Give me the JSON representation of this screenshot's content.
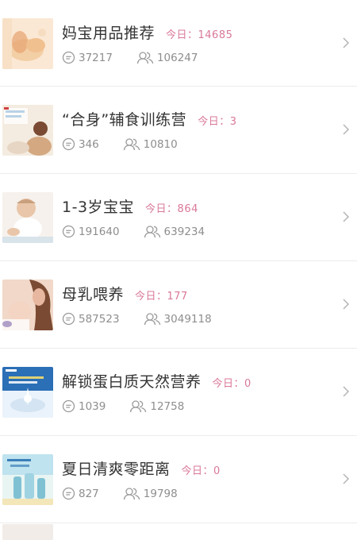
{
  "forum_list": [
    {
      "title": "妈宝用品推荐",
      "today": "今日：14685",
      "posts": "37217",
      "members": "106247",
      "thumb_icon": "baby-feet-image",
      "thumb_colors": [
        "#f3cfa6",
        "#e7a36f",
        "#fbe8d4"
      ]
    },
    {
      "title": "“合身”辅食训练营",
      "today": "今日：3",
      "posts": "346",
      "members": "10810",
      "thumb_icon": "mother-feeding-image",
      "thumb_colors": [
        "#f4ece0",
        "#d4a982",
        "#b8d2e6"
      ]
    },
    {
      "title": "1-3岁宝宝",
      "today": "今日：864",
      "posts": "191640",
      "members": "639234",
      "thumb_icon": "toddler-image",
      "thumb_colors": [
        "#f6f1ec",
        "#e9c6a9",
        "#d8e3ea"
      ]
    },
    {
      "title": "母乳喂养",
      "today": "今日：177",
      "posts": "587523",
      "members": "3049118",
      "thumb_icon": "breastfeeding-image",
      "thumb_colors": [
        "#f1d8c8",
        "#7a4a32",
        "#e8b7a0"
      ]
    },
    {
      "title": "解锁蛋白质天然营养",
      "today": "今日：0",
      "posts": "1039",
      "members": "12758",
      "thumb_icon": "milk-nutrition-ad-image",
      "thumb_colors": [
        "#2b6fb6",
        "#eaf3fb",
        "#d4e4f2"
      ]
    },
    {
      "title": "夏日清爽零距离",
      "today": "今日：0",
      "posts": "827",
      "members": "19798",
      "thumb_icon": "summer-bottles-image",
      "thumb_colors": [
        "#bfe3ef",
        "#e9f5f3",
        "#7fc1d3"
      ]
    }
  ],
  "icons": {
    "posts": "comment-bubble-icon",
    "members": "group-members-icon",
    "arrow": "chevron-right-icon"
  },
  "colors": {
    "today": "#d9789a",
    "title": "#333333",
    "stats": "#8e8e8e",
    "divider": "#ececec"
  }
}
